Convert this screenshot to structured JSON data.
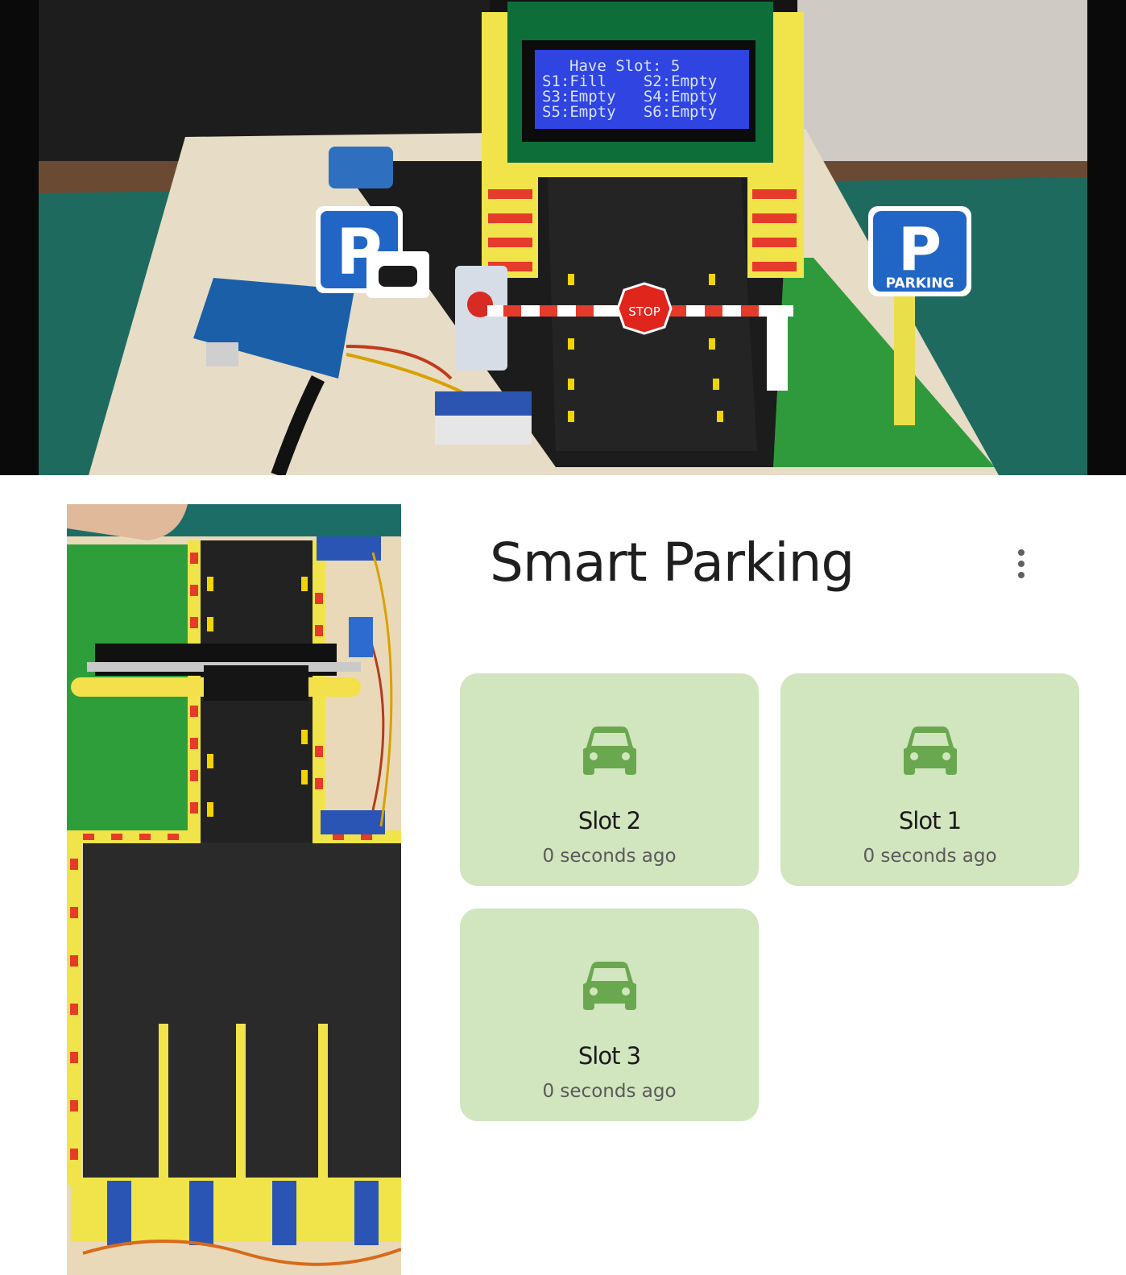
{
  "top_photo": {
    "lcd": {
      "lines": [
        "Have Slot: 5",
        "S1:Fill    S2:Empty",
        "S3:Empty   S4:Empty",
        "S5:Empty   S6:Empty"
      ]
    },
    "signs": {
      "parking_letter": "P",
      "parking_word": "PARKING",
      "stop": "STOP"
    }
  },
  "app": {
    "title": "Smart Parking",
    "menu_icon": "more-vertical-icon",
    "accent_color": "#d1e5be",
    "icon_color": "#6aa84f",
    "slots": [
      {
        "name": "Slot 2",
        "time": "0 seconds ago",
        "icon": "car-icon"
      },
      {
        "name": "Slot 1",
        "time": "0 seconds ago",
        "icon": "car-icon"
      },
      {
        "name": "Slot 3",
        "time": "0 seconds ago",
        "icon": "car-icon"
      }
    ]
  }
}
